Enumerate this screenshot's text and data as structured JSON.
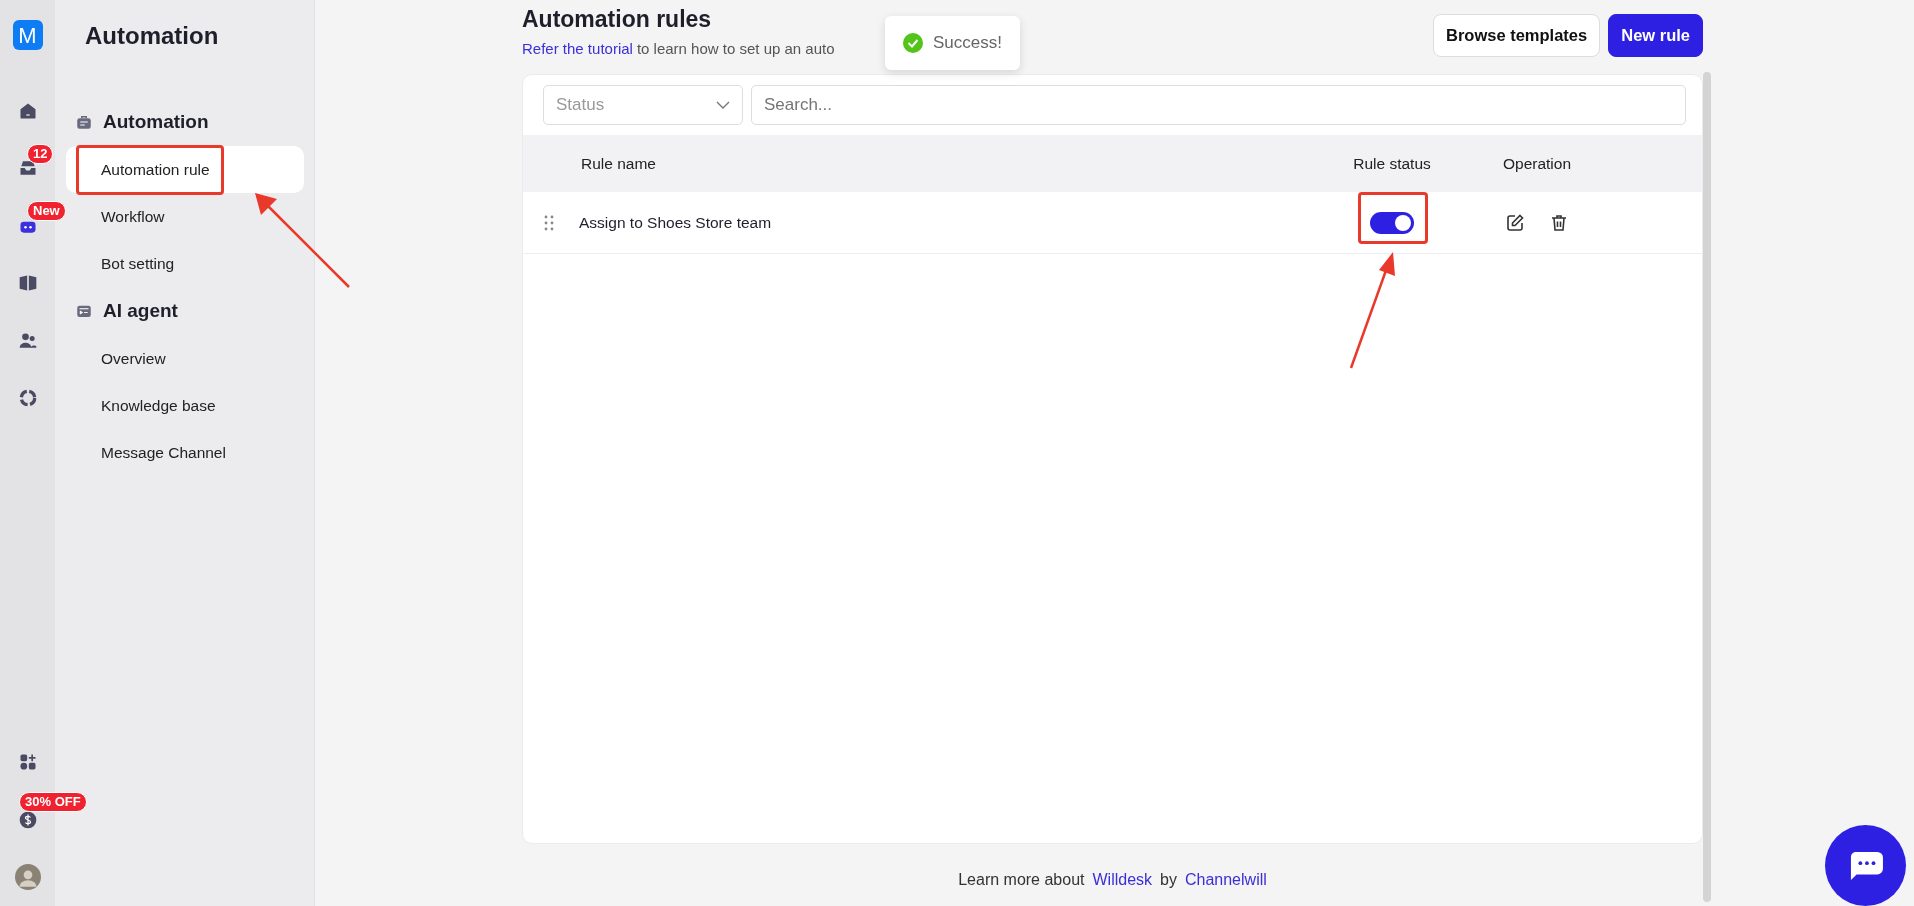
{
  "rail": {
    "logo": "M",
    "top_items": [
      {
        "kind": "home"
      },
      {
        "kind": "inbox",
        "badge": "12"
      },
      {
        "kind": "bot",
        "badge": "New"
      },
      {
        "kind": "book"
      },
      {
        "kind": "users"
      },
      {
        "kind": "chart"
      }
    ],
    "bottom_items": [
      {
        "kind": "apps"
      },
      {
        "kind": "billing",
        "badge": "30% OFF"
      },
      {
        "kind": "avatar"
      }
    ]
  },
  "sidebar": {
    "title": "Automation",
    "sections": [
      {
        "kind": "automation",
        "label": "Automation",
        "items": [
          {
            "label": "Automation rule",
            "selected": true,
            "highlighted": true
          },
          {
            "label": "Workflow",
            "selected": false,
            "highlighted": false
          },
          {
            "label": "Bot setting",
            "selected": false,
            "highlighted": false
          }
        ]
      },
      {
        "kind": "ai",
        "label": "AI agent",
        "items": [
          {
            "label": "Overview",
            "selected": false,
            "highlighted": false
          },
          {
            "label": "Knowledge base",
            "selected": false,
            "highlighted": false
          },
          {
            "label": "Message Channel",
            "selected": false,
            "highlighted": false
          }
        ]
      }
    ]
  },
  "header": {
    "title": "Automation rules",
    "link": "Refer the tutorial",
    "subtitle": "to learn how to set up an auto",
    "buttons": [
      {
        "label": "Browse templates",
        "kind": "secondary"
      },
      {
        "label": "New rule",
        "kind": "primary"
      }
    ]
  },
  "toast": {
    "text": "Success!"
  },
  "filters": {
    "status": {
      "placeholder": "Status"
    },
    "search": {
      "placeholder": "Search..."
    }
  },
  "table": {
    "columns": [
      "Rule name",
      "Rule status",
      "Operation"
    ],
    "rows": [
      {
        "name": "Assign to Shoes Store team",
        "on": true,
        "highlighted": true
      }
    ]
  },
  "footer": {
    "text": "Learn more about",
    "link1": "Willdesk",
    "middle": "by",
    "link2": "Channelwill"
  }
}
